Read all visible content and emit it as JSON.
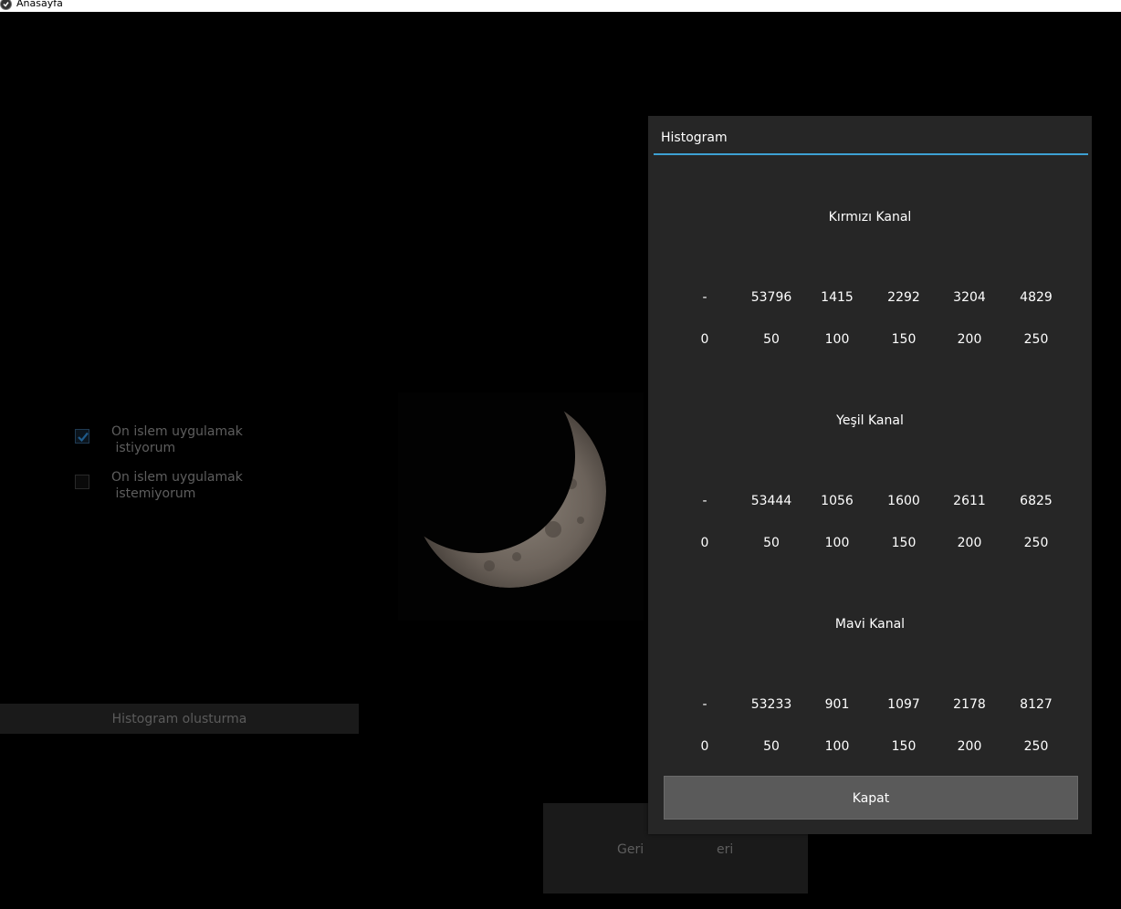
{
  "window": {
    "title": "Anasayfa"
  },
  "options": [
    {
      "line1": "On islem uygulamak",
      "line2": " istiyorum",
      "checked": true
    },
    {
      "line1": "On islem uygulamak",
      "line2": " istemiyorum",
      "checked": false
    }
  ],
  "histogram_button": "Histogram olusturma",
  "bottom": {
    "back": "Geri",
    "next_partial": "eri"
  },
  "popup": {
    "title": "Histogram",
    "close_label": "Kapat",
    "channels": [
      {
        "name": "Kırmızı Kanal",
        "counts": [
          "-",
          "53796",
          "1415",
          "2292",
          "3204",
          "4829"
        ],
        "bins": [
          "0",
          "50",
          "100",
          "150",
          "200",
          "250"
        ]
      },
      {
        "name": "Yeşil Kanal",
        "counts": [
          "-",
          "53444",
          "1056",
          "1600",
          "2611",
          "6825"
        ],
        "bins": [
          "0",
          "50",
          "100",
          "150",
          "200",
          "250"
        ]
      },
      {
        "name": "Mavi Kanal",
        "counts": [
          "-",
          "53233",
          "901",
          "1097",
          "2178",
          "8127"
        ],
        "bins": [
          "0",
          "50",
          "100",
          "150",
          "200",
          "250"
        ]
      }
    ]
  },
  "colors": {
    "accent": "#3da0d3",
    "checkbox": "#1e5a8a"
  }
}
